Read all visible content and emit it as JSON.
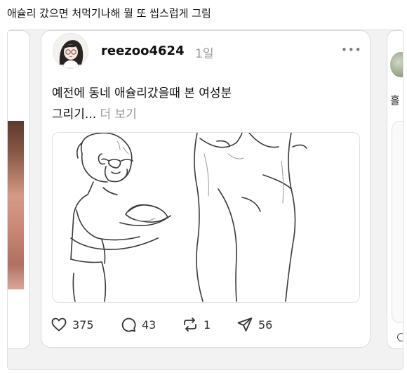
{
  "caption": "애슐리 갔으면 처먹기나해 뭘 또 씹스럽게 그림",
  "post": {
    "username": "reezoo4624",
    "time": "1일",
    "more_icon": "more-horizontal-icon",
    "text_line1": "예전에 동네 애슐리갔을때 본 여성분",
    "text_line2": "그리기...",
    "more_link": "더 보기",
    "stats": {
      "likes": "375",
      "comments": "43",
      "reposts": "1",
      "shares": "56"
    }
  },
  "right_card": {
    "fragment": "흘"
  }
}
